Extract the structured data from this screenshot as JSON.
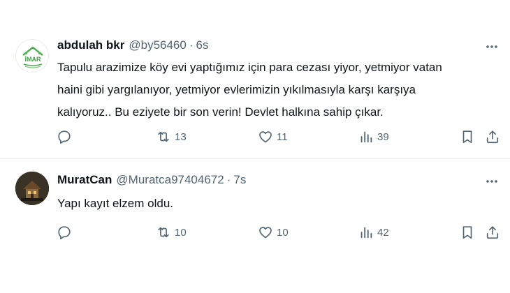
{
  "tweets": [
    {
      "name": "abdulah bkr",
      "handle": "@by56460",
      "separator": "·",
      "time": "6s",
      "avatar_text": "İMAR",
      "text_lines": [
        "Tapulu arazimize köy evi yaptığımız için para cezası yiyor, yetmiyor vatan",
        "haini gibi yargılanıyor, yetmiyor evlerimizin yıkılmasıyla karşı karşıya",
        "kalıyoruz.. Bu eziyete bir son verin! Devlet halkına sahip çıkar."
      ],
      "reposts": "13",
      "likes": "11",
      "views": "39"
    },
    {
      "name": "MuratCan",
      "handle": "@Muratca97404672",
      "separator": "·",
      "time": "7s",
      "text_lines": [
        "Yapı kayıt elzem oldu."
      ],
      "reposts": "10",
      "likes": "10",
      "views": "42"
    }
  ],
  "icons": {
    "more": "more-horizontal-icon",
    "reply": "reply-icon",
    "repost": "repost-icon",
    "like": "heart-icon",
    "views": "views-icon",
    "bookmark": "bookmark-icon",
    "share": "share-icon"
  },
  "colors": {
    "text": "#0f1419",
    "secondary": "#536471",
    "divider": "#eff3f4",
    "logo_green": "#4caf50"
  }
}
